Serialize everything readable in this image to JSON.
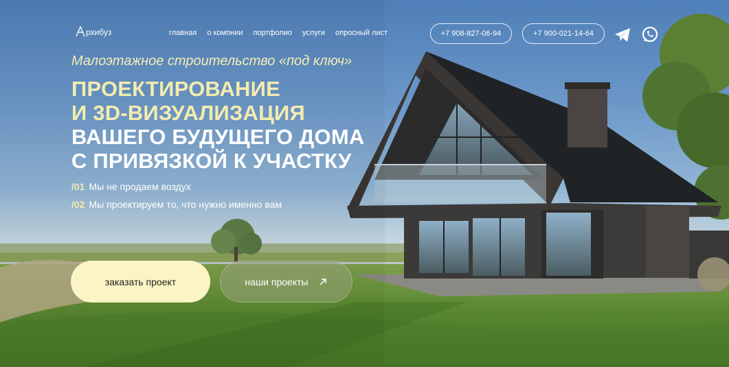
{
  "brand": {
    "logo_text": "рхибуз"
  },
  "nav": {
    "items": [
      {
        "label": "главная"
      },
      {
        "label": "о компнии"
      },
      {
        "label": "портфолио"
      },
      {
        "label": "услуги"
      },
      {
        "label": "опросный лист"
      }
    ],
    "phones": [
      "+7 908-827-06-94",
      "+7 900-021-14-64"
    ],
    "social_icons": [
      "telegram-icon",
      "whatsapp-icon"
    ]
  },
  "hero": {
    "subtitle": "Малоэтажное строительство «под ключ»",
    "headline": [
      "ПРОЕКТИРОВАНИЕ",
      "И 3D-ВИЗУАЛИЗАЦИЯ",
      "ВАШЕГО БУДУЩЕГО ДОМА",
      "С ПРИВЯЗКОЙ К УЧАСТКУ"
    ],
    "points": [
      {
        "num": "/01",
        "text": "Мы не продаем воздух"
      },
      {
        "num": "/02",
        "text": "Мы проектируем то, что нужно именно вам"
      }
    ],
    "buttons": {
      "order": "заказать проект",
      "projects": "наши проекты"
    }
  },
  "colors": {
    "accent_yellow": "#f3ecae",
    "button_light": "#fbf4c5",
    "sky_top": "#4f7fb8",
    "grass": "#5c8a33"
  }
}
